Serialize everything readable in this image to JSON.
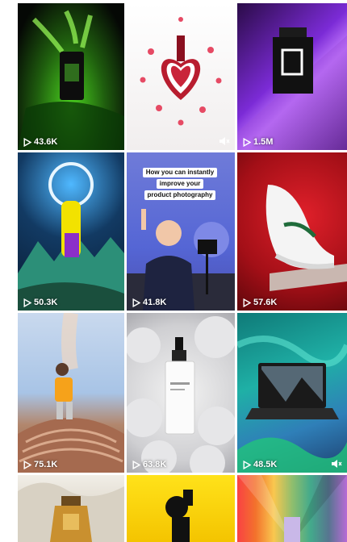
{
  "grid": {
    "tiles": [
      {
        "name": "tile-green-bottle",
        "views": "43.6K",
        "muted": false
      },
      {
        "name": "tile-lipstick-hearts",
        "views": "",
        "muted": true
      },
      {
        "name": "tile-purple-bottle",
        "views": "1.5M",
        "muted": false
      },
      {
        "name": "tile-astronaut-mountains",
        "views": "50.3K",
        "muted": false
      },
      {
        "name": "tile-man-camera",
        "views": "41.8K",
        "muted": false,
        "caption": [
          "How you can instantly",
          "improve your",
          "product photography"
        ]
      },
      {
        "name": "tile-sneaker-red",
        "views": "57.6K",
        "muted": false
      },
      {
        "name": "tile-figure-sand",
        "views": "75.1K",
        "muted": false
      },
      {
        "name": "tile-serum-bottle",
        "views": "63.8K",
        "muted": false
      },
      {
        "name": "tile-laptop-waves",
        "views": "48.5K",
        "muted": true
      },
      {
        "name": "tile-perfume-gold",
        "views": "",
        "muted": false
      },
      {
        "name": "tile-camera-yellow",
        "views": "",
        "muted": false
      },
      {
        "name": "tile-rainbow",
        "views": "",
        "muted": false
      }
    ]
  },
  "icons": {
    "play": "play-icon",
    "mute": "mute-icon"
  },
  "colors": {
    "overlay_text": "#ffffff",
    "background": "#ffffff"
  }
}
